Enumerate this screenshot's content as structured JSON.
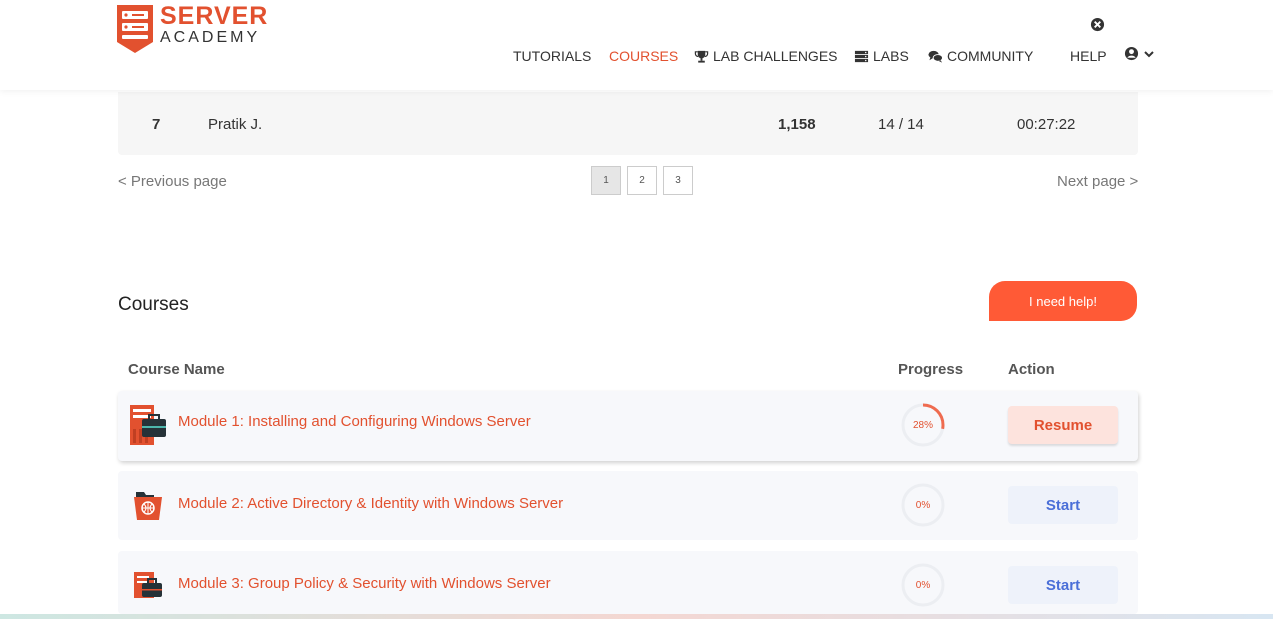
{
  "brand": {
    "line1": "SERVER",
    "line2": "ACADEMY",
    "color": "#e2512f"
  },
  "nav": {
    "items": [
      {
        "label": "TUTORIALS",
        "icon": ""
      },
      {
        "label": "COURSES",
        "icon": "",
        "active": true
      },
      {
        "label": "LAB CHALLENGES",
        "icon": "trophy-icon"
      },
      {
        "label": "LABS",
        "icon": "server-icon"
      },
      {
        "label": "COMMUNITY",
        "icon": "chat-icon"
      },
      {
        "label": "HELP",
        "icon": ""
      }
    ],
    "top_icon": "close-circle-icon",
    "user_icon": "user-circle-icon",
    "caret_icon": "chevron-down-icon"
  },
  "leaderboard_row": {
    "rank": "7",
    "name": "Pratik J.",
    "points": "1,158",
    "labs": "14 / 14",
    "time": "00:27:22"
  },
  "pager": {
    "prev": "< Previous page",
    "next": "Next page >",
    "pages": [
      "1",
      "2",
      "3"
    ],
    "current": "1"
  },
  "courses": {
    "title": "Courses",
    "help_button": "I need help!",
    "headers": {
      "name": "Course Name",
      "progress": "Progress",
      "action": "Action"
    },
    "rows": [
      {
        "name": "Module 1: Installing and Configuring Windows Server",
        "progress_label": "28%",
        "progress": 0.28,
        "action": "Resume",
        "icon": "server-briefcase-icon"
      },
      {
        "name": "Module 2: Active Directory & Identity with Windows Server",
        "progress_label": "0%",
        "progress": 0,
        "action": "Start",
        "icon": "folder-globe-icon"
      },
      {
        "name": "Module 3: Group Policy & Security with Windows Server",
        "progress_label": "0%",
        "progress": 0,
        "action": "Start",
        "icon": "document-briefcase-icon"
      }
    ]
  },
  "colors": {
    "accent": "#e2512f",
    "help_button": "#ff5a36",
    "start_text": "#4a6fd8"
  }
}
